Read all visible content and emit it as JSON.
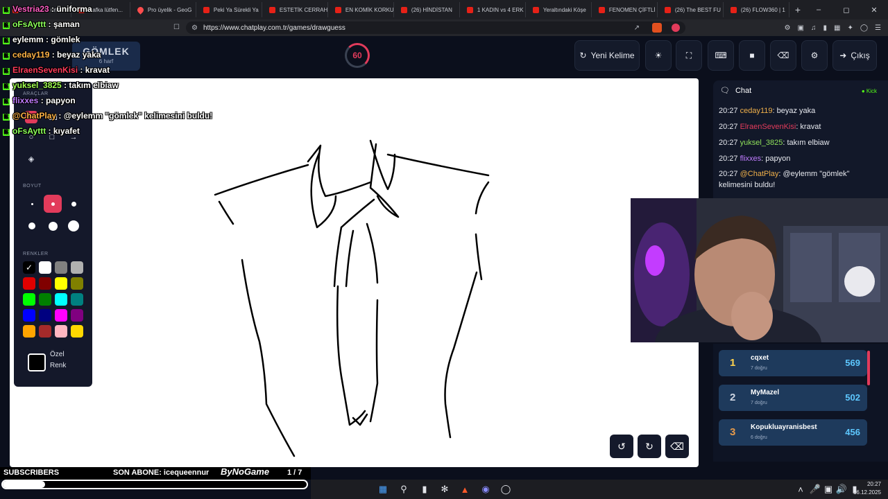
{
  "browser": {
    "tabs": [
      {
        "label": "Vestria23 : üniforma",
        "icon": "stream-icon"
      },
      {
        "label": "Kafka lütfen...",
        "icon": "youtube-icon"
      },
      {
        "label": "Pro üyelik - GeoG",
        "icon": "geoguessr-icon"
      },
      {
        "label": "Peki Ya Sürekli Ya",
        "icon": "youtube-icon"
      },
      {
        "label": "ESTETİK CERRAH",
        "icon": "youtube-icon"
      },
      {
        "label": "EN KOMİK KORKU",
        "icon": "youtube-icon"
      },
      {
        "label": "(26) HİNDİSTAN",
        "icon": "youtube-icon"
      },
      {
        "label": "1 KADIN vs 4 ERK",
        "icon": "youtube-icon"
      },
      {
        "label": "Yeraltındaki Köşe",
        "icon": "youtube-icon"
      },
      {
        "label": "FENOMEN ÇİFTLİ",
        "icon": "youtube-icon"
      },
      {
        "label": "(26) The BEST FU",
        "icon": "youtube-icon"
      },
      {
        "label": "(26) FLOW360 | 1",
        "icon": "youtube-icon"
      }
    ],
    "url": "https://www.chatplay.com.tr/games/drawguess"
  },
  "game": {
    "word": "GÖMLEK",
    "word_hint": "6 harf",
    "timer": "60",
    "buttons": {
      "new_word": "Yeni Kelime",
      "exit": "Çıkış"
    }
  },
  "tools": {
    "section_tools": "ARAÇLAR",
    "section_size": "BOYUT",
    "section_colors": "RENKLER",
    "custom_color_line1": "Özel",
    "custom_color_line2": "Renk",
    "colors": [
      "#000000",
      "#ffffff",
      "#808080",
      "#b0b0b0",
      "#e00000",
      "#800000",
      "#ffff00",
      "#808000",
      "#00ff00",
      "#008000",
      "#00ffff",
      "#008080",
      "#0000ff",
      "#000080",
      "#ff00ff",
      "#800080",
      "#ffa500",
      "#a52a2a",
      "#ffb6c1",
      "#ffd700"
    ]
  },
  "overlay_chat": [
    {
      "user": "Vestria23",
      "msg": " : üniforma",
      "color": "#ff5ec4"
    },
    {
      "user": "oFsAyttt",
      "msg": " : şaman",
      "color": "#8cff5a"
    },
    {
      "user": "eylemm",
      "msg": " : gömlek",
      "color": "#ffffff"
    },
    {
      "user": "ceday119",
      "msg": " : beyaz yaka",
      "color": "#ffb347"
    },
    {
      "user": "ElraenSevenKisi",
      "msg": " : kravat",
      "color": "#ff3b5c"
    },
    {
      "user": "yuksel_3825",
      "msg": " : takım elbiaw",
      "color": "#a0ff50"
    },
    {
      "user": "flixxes",
      "msg": " : papyon",
      "color": "#c07cff"
    },
    {
      "user": "@ChatPlay",
      "msg": " : @eylemm \"gömlek\" kelimesini buldu!",
      "color": "#ffb347"
    },
    {
      "user": "oFsAyttt",
      "msg": " : kıyafet",
      "color": "#8cff5a"
    }
  ],
  "chat": {
    "title": "Chat",
    "platform": "Kick",
    "messages": [
      {
        "time": "20:27",
        "user": "ceday119",
        "text": ": beyaz yaka",
        "color": "#f0b04a"
      },
      {
        "time": "20:27",
        "user": "ElraenSevenKisi",
        "text": ": kravat",
        "color": "#e23b5b"
      },
      {
        "time": "20:27",
        "user": "yuksel_3825",
        "text": ": takım elbiaw",
        "color": "#8fe05a"
      },
      {
        "time": "20:27",
        "user": "flixxes",
        "text": ": papyon",
        "color": "#c07cff"
      },
      {
        "time": "20:27",
        "user": "@ChatPlay",
        "text": ": @eylemm \"gömlek\" kelimesini buldu!",
        "color": "#f0b04a"
      }
    ]
  },
  "leaderboard": [
    {
      "rank": "1",
      "name": "cqxet",
      "sub": "7 doğru",
      "score": "569",
      "rank_color": "#ffd34d"
    },
    {
      "rank": "2",
      "name": "MyMazel",
      "sub": "7 doğru",
      "score": "502",
      "rank_color": "#cfd6e3"
    },
    {
      "rank": "3",
      "name": "Kopukluayranisbest",
      "sub": "6 doğru",
      "score": "456",
      "rank_color": "#e59a4b"
    }
  ],
  "stream": {
    "subscribers": "SUBSCRIBERS",
    "last_sub": "SON ABONE: icequeennur",
    "brand": "ByNoGame",
    "page": "1 / 7",
    "progress": 0.14
  },
  "taskbar": {
    "time": "20:27",
    "date": "16.12.2025"
  }
}
